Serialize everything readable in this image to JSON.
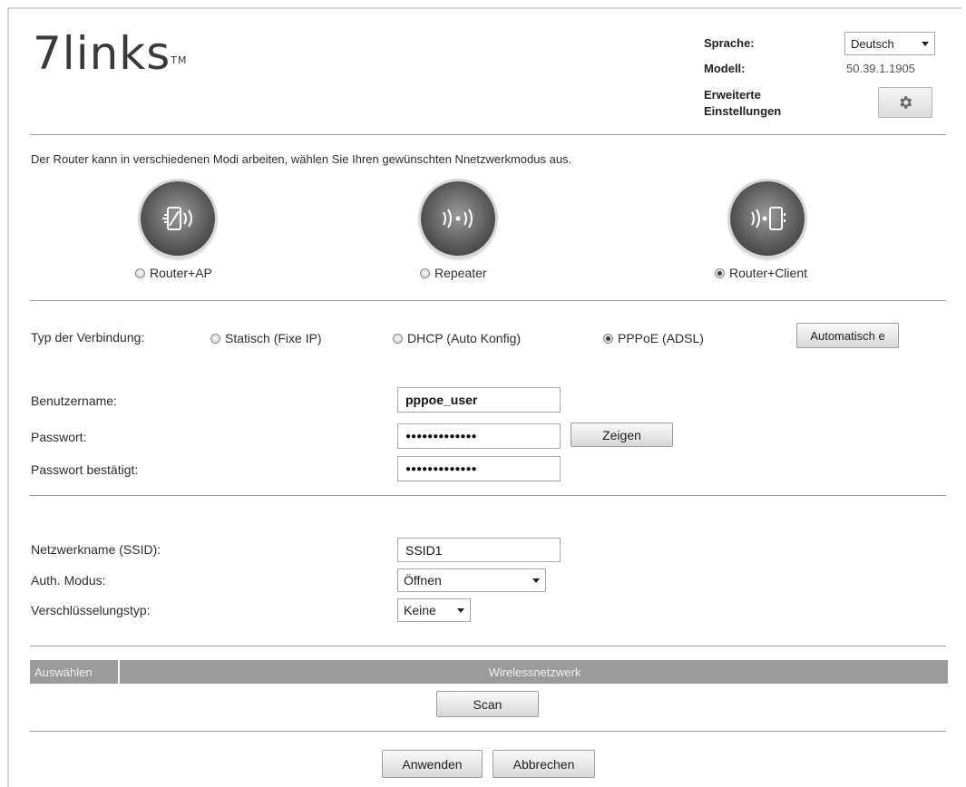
{
  "header": {
    "logo": "7links",
    "logo_tm": "TM",
    "language_label": "Sprache:",
    "language_value": "Deutsch",
    "model_label": "Modell:",
    "model_value": "50.39.1.1905",
    "advanced_label_line1": "Erweiterte",
    "advanced_label_line2": "Einstellungen",
    "gear_icon": "gear-icon"
  },
  "modes": {
    "intro": "Der Router kann in verschiedenen Modi arbeiten, wählen Sie Ihren gewünschten Nnetzwerkmodus aus.",
    "items": [
      {
        "label": "Router+AP",
        "icon": "router-ap-icon",
        "selected": false
      },
      {
        "label": "Repeater",
        "icon": "repeater-icon",
        "selected": false
      },
      {
        "label": "Router+Client",
        "icon": "router-client-icon",
        "selected": true
      }
    ]
  },
  "connection": {
    "label": "Typ der Verbindung:",
    "options": [
      {
        "label": "Statisch (Fixe IP)",
        "selected": false
      },
      {
        "label": "DHCP (Auto Konfig)",
        "selected": false
      },
      {
        "label": "PPPoE (ADSL)",
        "selected": true
      }
    ],
    "auto_button": "Automatisch e"
  },
  "pppoe": {
    "username_label": "Benutzername:",
    "username_value": "pppoe_user",
    "password_label": "Passwort:",
    "password_value": "●●●●●●●●●●●●●",
    "show_button": "Zeigen",
    "confirm_label": "Passwort bestätigt:",
    "confirm_value": "●●●●●●●●●●●●●"
  },
  "wireless": {
    "ssid_label": "Netzwerkname (SSID):",
    "ssid_value": "SSID1",
    "auth_label": "Auth. Modus:",
    "auth_value": "Öffnen",
    "enc_label": "Verschlüsselungstyp:",
    "enc_value": "Keine"
  },
  "scan_table": {
    "col_select": "Auswählen",
    "col_network": "Wirelessnetzwerk",
    "scan_button": "Scan"
  },
  "footer": {
    "apply_button": "Anwenden",
    "cancel_button": "Abbrechen"
  }
}
